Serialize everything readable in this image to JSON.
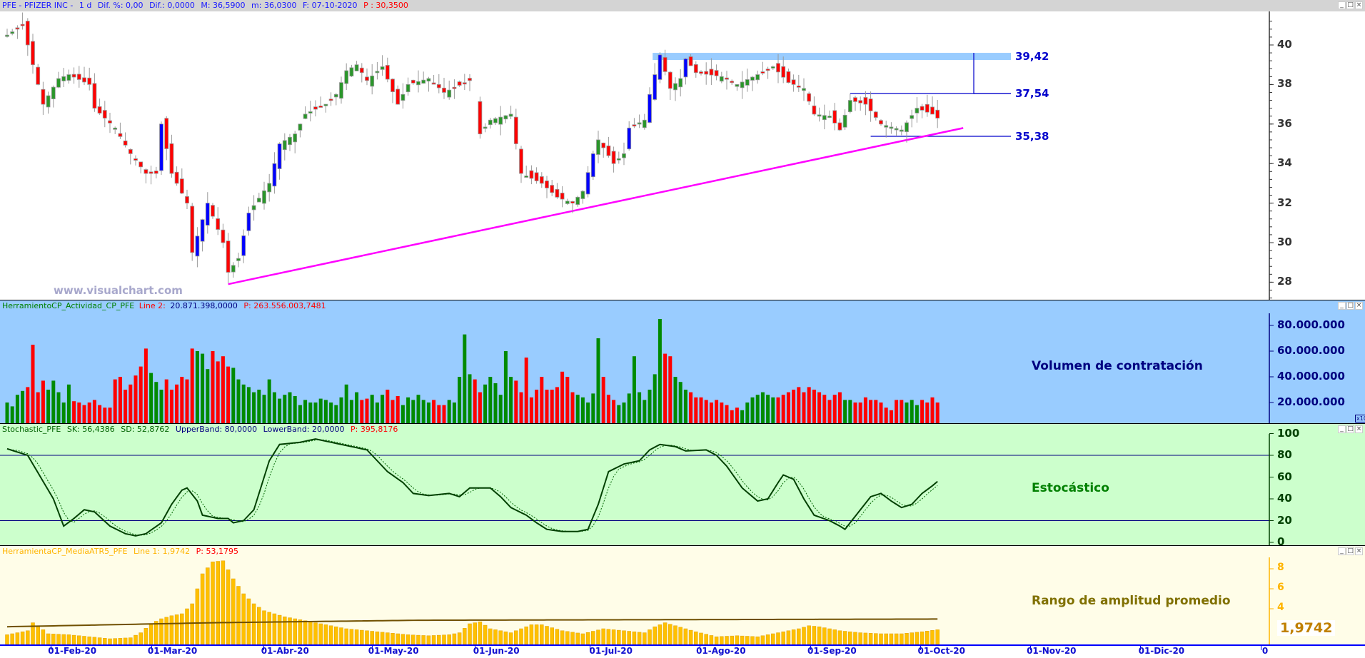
{
  "title_bar": {
    "symbol": "PFE - PFIZER INC -",
    "period": "1 d",
    "dif_pct": "Dif. %: 0,00",
    "dif": "Dif.: 0,0000",
    "max": "M: 36,5900",
    "min": "m: 36,0300",
    "date": "F: 07-10-2020",
    "p": "P : 30,3500"
  },
  "window_buttons": [
    "_",
    "□",
    "×"
  ],
  "watermark": "www.visualchart.com",
  "colors": {
    "up": "#2a962a",
    "down": "#ff0000",
    "strong_up": "#0000ff",
    "trend": "#ff00ff",
    "zone": "#99ccff",
    "level": "#0000cc"
  },
  "chart_data": [
    {
      "type": "candlestick",
      "name": "price",
      "ylim": [
        27,
        41.5
      ],
      "y_ticks": [
        28,
        30,
        32,
        34,
        36,
        38,
        40
      ],
      "close_keyframes": [
        [
          0,
          40.5
        ],
        [
          3,
          41.0
        ],
        [
          5,
          39.0
        ],
        [
          7,
          37.0
        ],
        [
          10,
          38.3
        ],
        [
          12,
          38.5
        ],
        [
          16,
          38.0
        ],
        [
          17,
          36.8
        ],
        [
          21,
          35.8
        ],
        [
          24,
          34.5
        ],
        [
          27,
          33.5
        ],
        [
          29,
          33.5
        ],
        [
          30,
          36.0
        ],
        [
          32,
          33.5
        ],
        [
          35,
          32.0
        ],
        [
          36,
          29.5
        ],
        [
          39,
          32.0
        ],
        [
          42,
          30.0
        ],
        [
          43,
          28.5
        ],
        [
          45,
          29.2
        ],
        [
          47,
          31.5
        ],
        [
          51,
          33.0
        ],
        [
          53,
          35.0
        ],
        [
          56,
          35.5
        ],
        [
          58,
          36.5
        ],
        [
          62,
          37.0
        ],
        [
          64,
          37.5
        ],
        [
          66,
          38.7
        ],
        [
          68,
          39.0
        ],
        [
          70,
          38.2
        ],
        [
          73,
          38.9
        ],
        [
          76,
          37.0
        ],
        [
          78,
          38.0
        ],
        [
          82,
          38.3
        ],
        [
          85,
          37.6
        ],
        [
          90,
          38.2
        ],
        [
          92,
          35.5
        ],
        [
          94,
          36.2
        ],
        [
          98,
          36.5
        ],
        [
          99,
          35.0
        ],
        [
          100,
          33.5
        ],
        [
          104,
          33.0
        ],
        [
          107,
          32.3
        ],
        [
          110,
          32.0
        ],
        [
          112,
          32.6
        ],
        [
          114,
          34.5
        ],
        [
          115,
          35.2
        ],
        [
          118,
          34.0
        ],
        [
          120,
          34.5
        ],
        [
          121,
          35.8
        ],
        [
          124,
          36.2
        ],
        [
          125,
          37.5
        ],
        [
          127,
          39.5
        ],
        [
          129,
          37.8
        ],
        [
          131,
          38.3
        ],
        [
          132,
          39.3
        ],
        [
          134,
          38.6
        ],
        [
          139,
          38.4
        ],
        [
          142,
          38.0
        ],
        [
          146,
          38.5
        ],
        [
          149,
          38.9
        ],
        [
          152,
          38.1
        ],
        [
          155,
          37.8
        ],
        [
          157,
          36.5
        ],
        [
          160,
          36.4
        ],
        [
          162,
          35.7
        ],
        [
          164,
          37.2
        ],
        [
          167,
          37.0
        ],
        [
          170,
          36.0
        ],
        [
          174,
          35.7
        ],
        [
          177,
          36.8
        ],
        [
          180,
          36.5
        ],
        [
          181,
          36.3
        ]
      ],
      "bars": 182,
      "levels": [
        {
          "label": "39,42",
          "value": 39.42,
          "from_bar": 126,
          "style": "zone"
        },
        {
          "label": "37,54",
          "value": 37.54,
          "from_bar": 164,
          "style": "line"
        },
        {
          "label": "35,38",
          "value": 35.38,
          "from_bar": 168,
          "style": "line"
        }
      ],
      "trendline": [
        [
          43,
          27.9
        ],
        [
          186,
          35.8
        ]
      ],
      "measure": {
        "bar": 193,
        "from": 37.54,
        "to": 39.42
      }
    },
    {
      "type": "bar",
      "name": "volume",
      "header": {
        "name": "HerramientoCP_Actividad_CP_PFE",
        "line": "Line 2:",
        "line_value": "20.871.398,0000",
        "p": "P: 263.556.003,7481"
      },
      "label": "Volumen de contratación",
      "y_ticks": [
        "80.000.000",
        "60.000.000",
        "40.000.000",
        "20.000.000"
      ],
      "y_tick_values": [
        80,
        60,
        40,
        20
      ],
      "unit": "millions",
      "scale_badge": "x10",
      "values": [
        20,
        17,
        26,
        29,
        32,
        65,
        28,
        37,
        30,
        37,
        28,
        20,
        34,
        21,
        20,
        18,
        20,
        22,
        18,
        16,
        16,
        38,
        40,
        30,
        34,
        41,
        48,
        62,
        43,
        36,
        30,
        38,
        30,
        34,
        40,
        38,
        62,
        60,
        58,
        46,
        60,
        52,
        56,
        48,
        47,
        38,
        34,
        32,
        28,
        30,
        26,
        38,
        28,
        23,
        26,
        28,
        25,
        18,
        22,
        20,
        20,
        23,
        22,
        20,
        18,
        24,
        34,
        22,
        28,
        22,
        23,
        26,
        20,
        26,
        30,
        22,
        25,
        18,
        24,
        22,
        26,
        22,
        20,
        22,
        18,
        18,
        22,
        20,
        40,
        73,
        42,
        38,
        28,
        34,
        40,
        35,
        26,
        60,
        40,
        37,
        28,
        55,
        24,
        30,
        40,
        30,
        30,
        32,
        44,
        40,
        28,
        26,
        24,
        20,
        27,
        70,
        40,
        26,
        22,
        18,
        20,
        27,
        56,
        28,
        22,
        30,
        42,
        85,
        58,
        56,
        40,
        36,
        30,
        28,
        24,
        24,
        22,
        20,
        22,
        20,
        18,
        14,
        16,
        14,
        20,
        24,
        26,
        28,
        26,
        24,
        24,
        26,
        28,
        30,
        32,
        28,
        32,
        30,
        28,
        26,
        22,
        26,
        28,
        22,
        22,
        20,
        20,
        24,
        22,
        22,
        20,
        16,
        14,
        22,
        22,
        20,
        22,
        18,
        22,
        20,
        24,
        20
      ]
    },
    {
      "type": "line",
      "name": "stochastic",
      "header": {
        "name": "Stochastic_PFE",
        "sk": "SK: 56,4386",
        "sd": "SD: 52,8762",
        "upper": "UpperBand: 80,0000",
        "lower": "LowerBand: 20,0000",
        "p": "P: 395,8176"
      },
      "label": "Estocástico",
      "y_ticks": [
        "100",
        "80",
        "60",
        "40",
        "20",
        "0"
      ],
      "y_tick_values": [
        100,
        80,
        60,
        40,
        20,
        0
      ],
      "bands": [
        80,
        20
      ],
      "sk_keyframes": [
        [
          0,
          86
        ],
        [
          4,
          80
        ],
        [
          9,
          40
        ],
        [
          11,
          15
        ],
        [
          13,
          22
        ],
        [
          15,
          30
        ],
        [
          17,
          28
        ],
        [
          20,
          15
        ],
        [
          23,
          8
        ],
        [
          25,
          6
        ],
        [
          27,
          8
        ],
        [
          30,
          18
        ],
        [
          32,
          35
        ],
        [
          34,
          48
        ],
        [
          35,
          50
        ],
        [
          37,
          38
        ],
        [
          38,
          25
        ],
        [
          41,
          22
        ],
        [
          43,
          22
        ],
        [
          44,
          18
        ],
        [
          46,
          20
        ],
        [
          48,
          30
        ],
        [
          51,
          75
        ],
        [
          53,
          90
        ],
        [
          57,
          92
        ],
        [
          60,
          95
        ],
        [
          63,
          92
        ],
        [
          67,
          88
        ],
        [
          70,
          85
        ],
        [
          72,
          75
        ],
        [
          74,
          65
        ],
        [
          77,
          55
        ],
        [
          79,
          45
        ],
        [
          82,
          43
        ],
        [
          86,
          45
        ],
        [
          88,
          42
        ],
        [
          90,
          50
        ],
        [
          94,
          50
        ],
        [
          96,
          42
        ],
        [
          98,
          32
        ],
        [
          101,
          25
        ],
        [
          103,
          18
        ],
        [
          105,
          12
        ],
        [
          108,
          10
        ],
        [
          111,
          10
        ],
        [
          113,
          12
        ],
        [
          115,
          35
        ],
        [
          117,
          65
        ],
        [
          120,
          72
        ],
        [
          123,
          75
        ],
        [
          125,
          85
        ],
        [
          127,
          90
        ],
        [
          130,
          88
        ],
        [
          132,
          84
        ],
        [
          136,
          85
        ],
        [
          138,
          80
        ],
        [
          140,
          70
        ],
        [
          143,
          50
        ],
        [
          146,
          38
        ],
        [
          148,
          40
        ],
        [
          150,
          55
        ],
        [
          151,
          62
        ],
        [
          153,
          58
        ],
        [
          155,
          40
        ],
        [
          157,
          25
        ],
        [
          160,
          20
        ],
        [
          162,
          15
        ],
        [
          163,
          12
        ],
        [
          166,
          30
        ],
        [
          168,
          42
        ],
        [
          170,
          45
        ],
        [
          172,
          38
        ],
        [
          174,
          32
        ],
        [
          176,
          35
        ],
        [
          178,
          45
        ],
        [
          180,
          52
        ],
        [
          181,
          56
        ]
      ]
    },
    {
      "type": "bar",
      "name": "atr",
      "header": {
        "name": "HerramientaCP_MediaATR5_PFE",
        "line": "Line 1: 1,9742",
        "p": "P: 53,1795"
      },
      "label": "Rango de amplitud promedio",
      "y_ticks": [
        "8",
        "6",
        "4"
      ],
      "y_tick_values": [
        8,
        6,
        4
      ],
      "last_value": "1,9742",
      "atr_keyframes": [
        [
          0,
          1.4
        ],
        [
          4,
          1.8
        ],
        [
          5,
          2.6
        ],
        [
          6,
          2.3
        ],
        [
          8,
          1.5
        ],
        [
          12,
          1.4
        ],
        [
          16,
          1.2
        ],
        [
          20,
          1.0
        ],
        [
          24,
          1.1
        ],
        [
          26,
          1.6
        ],
        [
          28,
          2.5
        ],
        [
          30,
          3.0
        ],
        [
          32,
          3.3
        ],
        [
          34,
          3.5
        ],
        [
          36,
          4.5
        ],
        [
          38,
          7.5
        ],
        [
          40,
          8.7
        ],
        [
          42,
          8.8
        ],
        [
          44,
          7.0
        ],
        [
          46,
          5.5
        ],
        [
          48,
          4.5
        ],
        [
          50,
          3.8
        ],
        [
          54,
          3.2
        ],
        [
          58,
          2.8
        ],
        [
          62,
          2.4
        ],
        [
          66,
          2.0
        ],
        [
          70,
          1.8
        ],
        [
          74,
          1.6
        ],
        [
          78,
          1.4
        ],
        [
          82,
          1.3
        ],
        [
          86,
          1.4
        ],
        [
          88,
          1.6
        ],
        [
          90,
          2.5
        ],
        [
          92,
          2.7
        ],
        [
          94,
          2.0
        ],
        [
          98,
          1.6
        ],
        [
          100,
          2.0
        ],
        [
          102,
          2.4
        ],
        [
          104,
          2.4
        ],
        [
          108,
          1.8
        ],
        [
          112,
          1.5
        ],
        [
          116,
          2.0
        ],
        [
          120,
          1.8
        ],
        [
          124,
          1.6
        ],
        [
          126,
          2.2
        ],
        [
          128,
          2.6
        ],
        [
          130,
          2.3
        ],
        [
          134,
          1.7
        ],
        [
          138,
          1.2
        ],
        [
          142,
          1.3
        ],
        [
          146,
          1.2
        ],
        [
          150,
          1.6
        ],
        [
          154,
          2.0
        ],
        [
          156,
          2.3
        ],
        [
          158,
          2.2
        ],
        [
          162,
          1.8
        ],
        [
          166,
          1.6
        ],
        [
          170,
          1.5
        ],
        [
          174,
          1.5
        ],
        [
          178,
          1.7
        ],
        [
          181,
          1.9
        ]
      ],
      "avg_keyframes": [
        [
          0,
          1.2
        ],
        [
          40,
          1.6
        ],
        [
          80,
          1.85
        ],
        [
          181,
          1.97
        ]
      ]
    }
  ],
  "x_axis": {
    "ticks": [
      {
        "label": "01-Feb-20",
        "bar": 8.5
      },
      {
        "label": "01-Mar-20",
        "bar": 28
      },
      {
        "label": "01-Abr-20",
        "bar": 49.9
      },
      {
        "label": "01-May-20",
        "bar": 71
      },
      {
        "label": "01-Jun-20",
        "bar": 91
      },
      {
        "label": "01-Jul-20",
        "bar": 113.3
      },
      {
        "label": "01-Ago-20",
        "bar": 134.7
      },
      {
        "label": "01-Sep-20",
        "bar": 156.3
      },
      {
        "label": "01-Oct-20",
        "bar": 177.6
      },
      {
        "label": "01-Nov-20",
        "bar": 199
      },
      {
        "label": "01-Dic-20",
        "bar": 220.4
      },
      {
        "label": "0",
        "bar": 243.9
      }
    ]
  }
}
